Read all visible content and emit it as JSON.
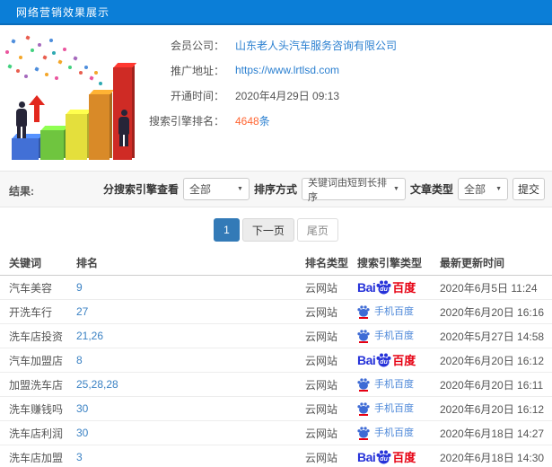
{
  "header": {
    "title": "网络营销效果展示"
  },
  "info": {
    "rows": [
      {
        "label": "会员公司：",
        "value": "山东老人头汽车服务咨询有限公司"
      },
      {
        "label": "推广地址：",
        "value": "https://www.lrtlsd.com"
      },
      {
        "label": "开通时间：",
        "value": "2020年4月29日 09:13"
      },
      {
        "label": "搜索引擎排名：",
        "value": "4648",
        "suffix": "条"
      }
    ]
  },
  "filters": {
    "result_label": "结果:",
    "engine_label": "分搜索引擎查看",
    "engine_value": "全部",
    "sort_label": "排序方式",
    "sort_value": "关键词由短到长排序",
    "article_label": "文章类型",
    "article_value": "全部",
    "submit_label": "提交",
    "caret": "▼"
  },
  "pagination": {
    "current": "1",
    "next": "下一页",
    "last": "尾页"
  },
  "brands": {
    "baidu_bai": "Bai",
    "baidu_du": "du",
    "baidu_cn": "百度",
    "mobile_text": "手机百度"
  },
  "table": {
    "headers": [
      "关键词",
      "排名",
      "排名类型",
      "搜索引擎类型",
      "最新更新时间"
    ],
    "rows": [
      {
        "keyword": "汽车美容",
        "rank": "9",
        "rank_type": "云网站",
        "engine": "baidu",
        "time": "2020年6月5日 11:24"
      },
      {
        "keyword": "开洗车行",
        "rank": "27",
        "rank_type": "云网站",
        "engine": "mobile",
        "time": "2020年6月20日 16:16"
      },
      {
        "keyword": "洗车店投资",
        "rank": "21,26",
        "rank_type": "云网站",
        "engine": "mobile",
        "time": "2020年5月27日 14:58"
      },
      {
        "keyword": "汽车加盟店",
        "rank": "8",
        "rank_type": "云网站",
        "engine": "baidu",
        "time": "2020年6月20日 16:12"
      },
      {
        "keyword": "加盟洗车店",
        "rank": "25,28,28",
        "rank_type": "云网站",
        "engine": "mobile",
        "time": "2020年6月20日 16:11"
      },
      {
        "keyword": "洗车赚钱吗",
        "rank": "30",
        "rank_type": "云网站",
        "engine": "mobile",
        "time": "2020年6月20日 16:12"
      },
      {
        "keyword": "洗车店利润",
        "rank": "30",
        "rank_type": "云网站",
        "engine": "mobile",
        "time": "2020年6月18日 14:27"
      },
      {
        "keyword": "洗车店加盟",
        "rank": "3",
        "rank_type": "云网站",
        "engine": "baidu",
        "time": "2020年6月18日 14:30"
      }
    ]
  },
  "colors": {
    "header_blue": "#0b7ed7",
    "link_blue": "#2a7fd0",
    "rank_orange": "#ff6633",
    "pagination_active": "#337ab7",
    "baidu_blue": "#2632d9",
    "baidu_red": "#e60012"
  }
}
